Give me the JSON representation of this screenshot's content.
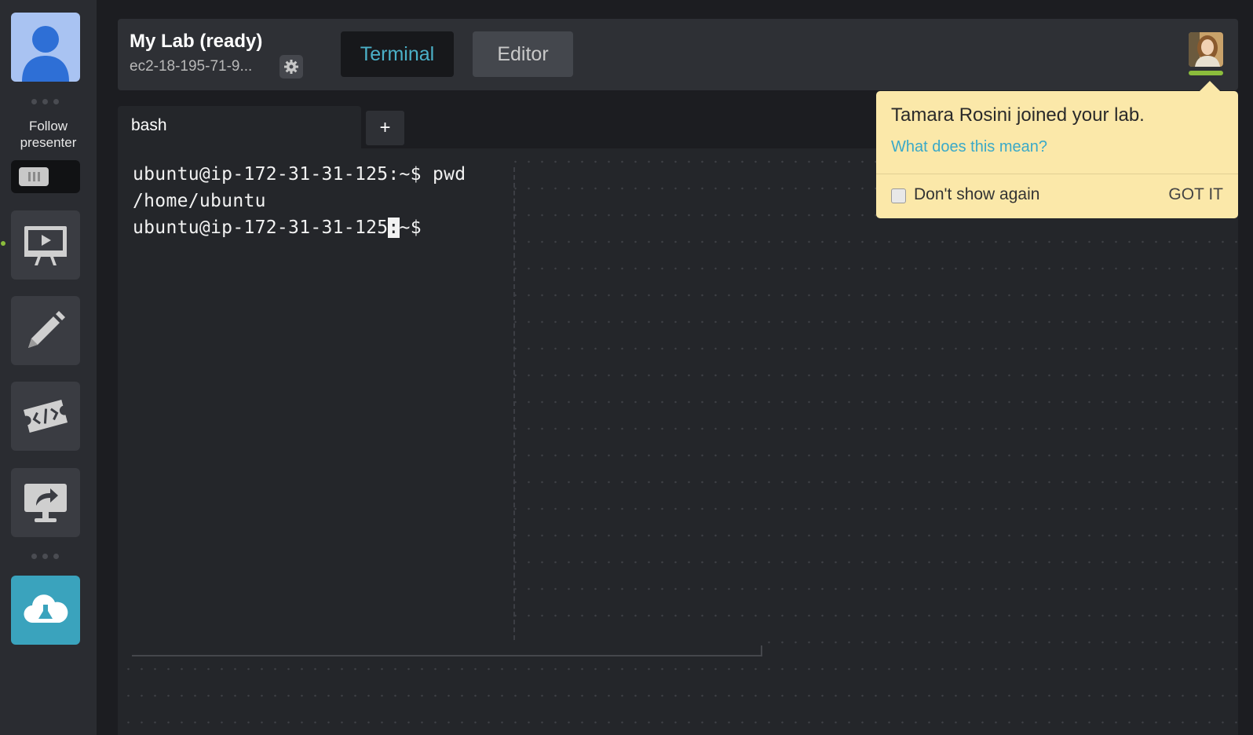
{
  "sidebar": {
    "follow_label_line1": "Follow",
    "follow_label_line2": "presenter"
  },
  "header": {
    "lab_title": "My Lab (ready)",
    "host": "ec2-18-195-71-9...",
    "tabs": [
      {
        "label": "Terminal",
        "active": true
      },
      {
        "label": "Editor",
        "active": false
      }
    ]
  },
  "terminal": {
    "tab_label": "bash",
    "add_tab_label": "+",
    "lines": [
      "ubuntu@ip-172-31-31-125:~$ pwd",
      "/home/ubuntu"
    ],
    "prompt_before_cursor": "ubuntu@ip-172-31-31-125",
    "cursor_char": ":",
    "prompt_after_cursor": "~$"
  },
  "notification": {
    "message": "Tamara Rosini joined your lab.",
    "link": "What does this mean?",
    "checkbox_label": "Don't show again",
    "dismiss_label": "GOT IT"
  },
  "colors": {
    "accent": "#4bb1c8",
    "presence": "#8bbd3c",
    "notification_bg": "#fbe8a9",
    "cloud_button": "#3aa3bd"
  },
  "icons": {
    "avatar": "user-avatar-icon",
    "presentation": "presentation-screen-icon",
    "pen": "pen-icon",
    "code": "code-ticket-icon",
    "share": "share-screen-icon",
    "cloud": "cloud-lab-icon",
    "settings": "gear-icon"
  }
}
